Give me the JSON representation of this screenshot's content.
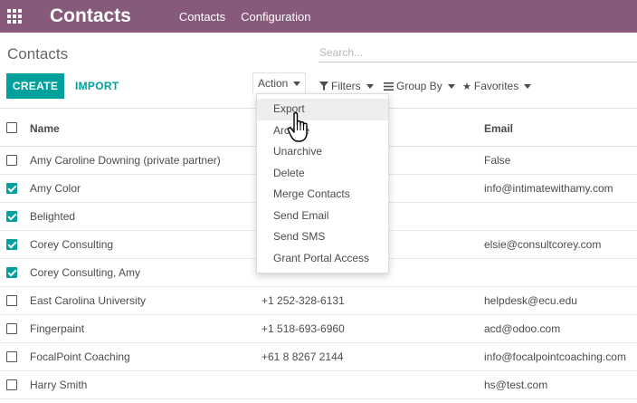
{
  "navbar": {
    "brand": "Contacts",
    "links": [
      "Contacts",
      "Configuration"
    ]
  },
  "control_panel": {
    "title": "Contacts",
    "search_placeholder": "Search...",
    "create_label": "CREATE",
    "import_label": "IMPORT",
    "action_label": "Action",
    "filters_label": "Filters",
    "group_by_label": "Group By",
    "favorites_label": "Favorites"
  },
  "table": {
    "columns": {
      "name": "Name",
      "phone": "",
      "email": "Email"
    },
    "rows": [
      {
        "name": "Amy Caroline Downing (private partner)",
        "phone": "",
        "email": "False",
        "checked": false
      },
      {
        "name": "Amy Color",
        "phone": "",
        "email": "info@intimatewithamy.com",
        "checked": true
      },
      {
        "name": "Belighted",
        "phone": "",
        "email": "",
        "checked": true
      },
      {
        "name": "Corey Consulting",
        "phone": "",
        "email": "elsie@consultcorey.com",
        "checked": true
      },
      {
        "name": "Corey Consulting, Amy",
        "phone": "",
        "email": "",
        "checked": true
      },
      {
        "name": "East Carolina University",
        "phone": "+1 252-328-6131",
        "email": "helpdesk@ecu.edu",
        "checked": false
      },
      {
        "name": "Fingerpaint",
        "phone": "+1 518-693-6960",
        "email": "acd@odoo.com",
        "checked": false
      },
      {
        "name": "FocalPoint Coaching",
        "phone": "+61 8 8267 2144",
        "email": "info@focalpointcoaching.com",
        "checked": false
      },
      {
        "name": "Harry Smith",
        "phone": "",
        "email": "hs@test.com",
        "checked": false
      }
    ]
  },
  "action_menu": {
    "items": [
      "Export",
      "Archive",
      "Unarchive",
      "Delete",
      "Merge Contacts",
      "Send Email",
      "Send SMS",
      "Grant Portal Access"
    ],
    "hovered_index": 0
  },
  "colors": {
    "navbar": "#875a7b",
    "primary": "#00a09d"
  }
}
